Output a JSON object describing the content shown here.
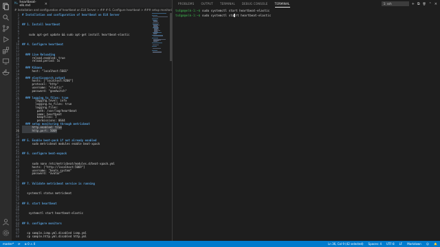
{
  "tab": {
    "icon": "M↓",
    "label": "heartbeat-elk.md",
    "close": "×"
  },
  "breadcrumb": "# Installation and configuration of heartbeat on ELK Server > ## # 6. Configure heartbeat > ### setup monitoring throu",
  "editor": {
    "lines": [
      {
        "n": "1",
        "t": "# Installation and configuration of heartbeat on ELK Server",
        "k": "h"
      },
      {
        "n": "2",
        "t": "",
        "k": ""
      },
      {
        "n": "3",
        "t": "",
        "k": ""
      },
      {
        "n": "4",
        "t": "## 1. Install heartbeat",
        "k": "h"
      },
      {
        "n": "5",
        "t": "",
        "k": ""
      },
      {
        "n": "6",
        "t": "",
        "k": ""
      },
      {
        "n": "7",
        "t": "    sudo apt-get update && sudo apt-get install heartbeat-elastic",
        "k": ""
      },
      {
        "n": "8",
        "t": "",
        "k": ""
      },
      {
        "n": "9",
        "t": "",
        "k": ""
      },
      {
        "n": "10",
        "t": "## 4. Configure heartbeat",
        "k": "h"
      },
      {
        "n": "11",
        "t": "",
        "k": ""
      },
      {
        "n": "12",
        "t": "",
        "k": ""
      },
      {
        "n": "13",
        "t": "  ### Live Reloading",
        "k": "h"
      },
      {
        "n": "14",
        "t": "      reload.enabled: true",
        "k": ""
      },
      {
        "n": "15",
        "t": "      reload.period: 5s",
        "k": ""
      },
      {
        "n": "16",
        "t": "",
        "k": ""
      },
      {
        "n": "17",
        "t": "  ### Kibana",
        "k": "h"
      },
      {
        "n": "18",
        "t": "      host: \"localhost:5601\"",
        "k": ""
      },
      {
        "n": "19",
        "t": "",
        "k": ""
      },
      {
        "n": "20",
        "t": "  ### elasticsearch output",
        "k": "h"
      },
      {
        "n": "21",
        "t": "      hosts: [\"localhost:9200\"]",
        "k": ""
      },
      {
        "n": "22",
        "t": "      protocol: \"http\"",
        "k": ""
      },
      {
        "n": "23",
        "t": "      username: \"elastic\"",
        "k": ""
      },
      {
        "n": "24",
        "t": "      password: \"goodwitch\"",
        "k": ""
      },
      {
        "n": "25",
        "t": "",
        "k": ""
      },
      {
        "n": "26",
        "t": "  ### logging_to_files: true",
        "k": "h"
      },
      {
        "n": "27",
        "t": "        logging.level: info",
        "k": ""
      },
      {
        "n": "28",
        "t": "        logging.to_files: true",
        "k": ""
      },
      {
        "n": "29",
        "t": "        logging.files:",
        "k": ""
      },
      {
        "n": "30",
        "t": "         path: /var/log/heartbeat",
        "k": ""
      },
      {
        "n": "31",
        "t": "         name: heartbeat",
        "k": ""
      },
      {
        "n": "32",
        "t": "         keepfiles: 7",
        "k": ""
      },
      {
        "n": "33",
        "t": "         permissions: 0644",
        "k": ""
      },
      {
        "n": "34",
        "t": "  ### setup monitoring through metricbeat",
        "k": "h"
      },
      {
        "n": "35",
        "t": "      http.enabled: true",
        "k": "sel"
      },
      {
        "n": "36",
        "t": "      http.port: 5069",
        "k": "sel"
      },
      {
        "n": "37",
        "t": "",
        "k": ""
      },
      {
        "n": "38",
        "t": "",
        "k": ""
      },
      {
        "n": "39",
        "t": "## 5. Enable beat-pack if not already enabled",
        "k": "h"
      },
      {
        "n": "40",
        "t": "      sudo metricbeat modules enable beat-xpack",
        "k": ""
      },
      {
        "n": "41",
        "t": "",
        "k": ""
      },
      {
        "n": "42",
        "t": "",
        "k": ""
      },
      {
        "n": "43",
        "t": "## 6. configure beat-expack",
        "k": "h"
      },
      {
        "n": "44",
        "t": "",
        "k": ""
      },
      {
        "n": "45",
        "t": "",
        "k": ""
      },
      {
        "n": "46",
        "t": "      sudo nano /etc/metricbeat/modules.d/beat-xpack.yml",
        "k": ""
      },
      {
        "n": "47",
        "t": "      hosts: [\"http://localhost:5069\"]",
        "k": ""
      },
      {
        "n": "48",
        "t": "      username: \"beats_system\"",
        "k": ""
      },
      {
        "n": "49",
        "t": "      password: \"avatar\"",
        "k": ""
      },
      {
        "n": "50",
        "t": "",
        "k": ""
      },
      {
        "n": "51",
        "t": "",
        "k": ""
      },
      {
        "n": "52",
        "t": "## 7. Validate metricbeat service is running",
        "k": "h"
      },
      {
        "n": "53",
        "t": "",
        "k": ""
      },
      {
        "n": "54",
        "t": "",
        "k": ""
      },
      {
        "n": "55",
        "t": "   systemctl status metricbeat",
        "k": ""
      },
      {
        "n": "56",
        "t": "",
        "k": ""
      },
      {
        "n": "57",
        "t": "",
        "k": ""
      },
      {
        "n": "58",
        "t": "## 8. start heartbeat",
        "k": "h"
      },
      {
        "n": "59",
        "t": "",
        "k": ""
      },
      {
        "n": "60",
        "t": "",
        "k": ""
      },
      {
        "n": "61",
        "t": "    systemctl start heartbeat-elastic",
        "k": ""
      },
      {
        "n": "62",
        "t": "",
        "k": ""
      },
      {
        "n": "63",
        "t": "",
        "k": ""
      },
      {
        "n": "64",
        "t": "## 9. configure monitors",
        "k": "h"
      },
      {
        "n": "65",
        "t": "",
        "k": ""
      },
      {
        "n": "66",
        "t": "",
        "k": ""
      },
      {
        "n": "67",
        "t": "   cp sample.icmp.yml.disabled icmp.yml",
        "k": ""
      },
      {
        "n": "68",
        "t": "   cp sample.http.yml.disabled http.yml",
        "k": ""
      }
    ]
  },
  "panel": {
    "tabs": [
      "PROBLEMS",
      "OUTPUT",
      "TERMINAL",
      "DEBUG CONSOLE",
      "TERMINAL"
    ],
    "active_tab": "TERMINAL",
    "terminal_select": "1: ssh",
    "add_icon": "+",
    "split_icon": "⧉",
    "trash_icon": "🗑",
    "chevron_icon": "⌃",
    "close_icon": "×",
    "lines": [
      {
        "prompt": "ts4gm@elk-1:~$",
        "cmd": " sudo systemctl start heartbeat-elastic"
      },
      {
        "prompt": "ts4gm@elk-1:~$",
        "cmd": " sudo systemctl sta",
        "cursor": true,
        "rest": "rt heartbeat-elastic"
      }
    ]
  },
  "status": {
    "branch": "master*",
    "sync": "⟳",
    "errors": "⊗ 0 ⚠ 0",
    "position": "Ln 36, Col 9 (42 selected)",
    "spaces": "Spaces: 4",
    "encoding": "UTF-8",
    "eol": "LF",
    "language": "Markdown",
    "feedback": "☺",
    "bell": "🔔"
  },
  "colors": {
    "accent": "#007acc",
    "editor_bg": "#1e1e1e",
    "heading": "#569cd6",
    "prompt": "#3fb950"
  }
}
